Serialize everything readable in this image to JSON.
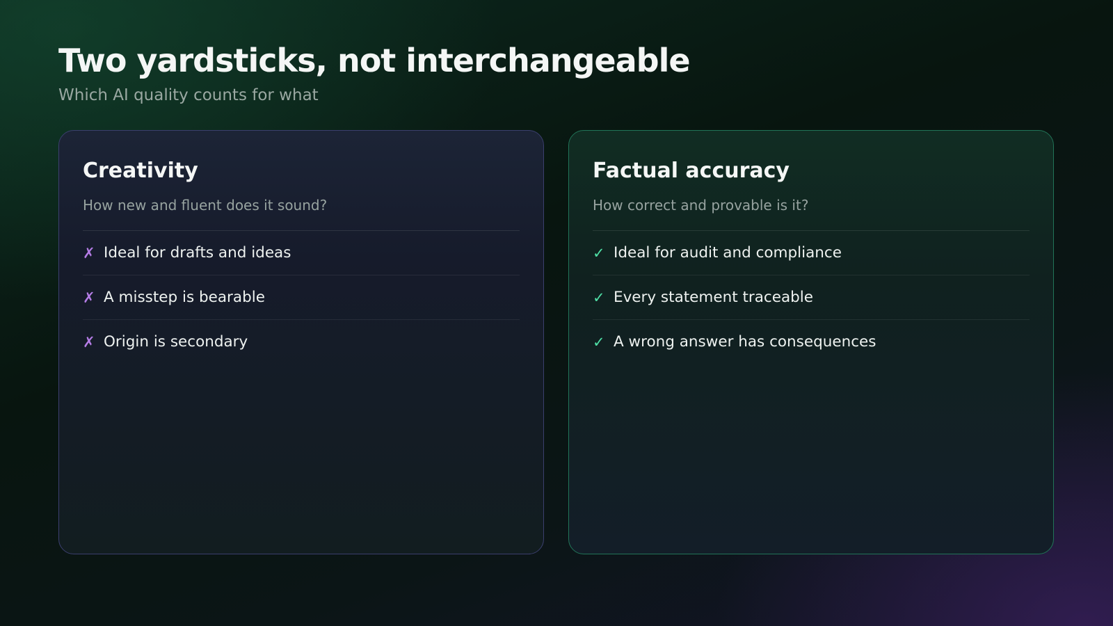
{
  "slide": {
    "title": "Two yardsticks, not interchangeable",
    "subtitle": "Which AI quality counts for what"
  },
  "cards": [
    {
      "title": "Creativity",
      "subtitle": "How new and fluent does it sound?",
      "accent_color": "#b57de6",
      "border_color": "#3b3f6e",
      "marker_icon": "cross-mark-icon",
      "items": [
        {
          "marker": "✗",
          "text": "Ideal for drafts and ideas"
        },
        {
          "marker": "✗",
          "text": "A misstep is bearable"
        },
        {
          "marker": "✗",
          "text": "Origin is secondary"
        }
      ]
    },
    {
      "title": "Factual accuracy",
      "subtitle": "How correct and provable is it?",
      "accent_color": "#4fe0a6",
      "border_color": "#217458",
      "marker_icon": "check-mark-icon",
      "items": [
        {
          "marker": "✓",
          "text": "Ideal for audit and compliance"
        },
        {
          "marker": "✓",
          "text": "Every statement traceable"
        },
        {
          "marker": "✓",
          "text": "A wrong answer has consequences"
        }
      ]
    }
  ]
}
